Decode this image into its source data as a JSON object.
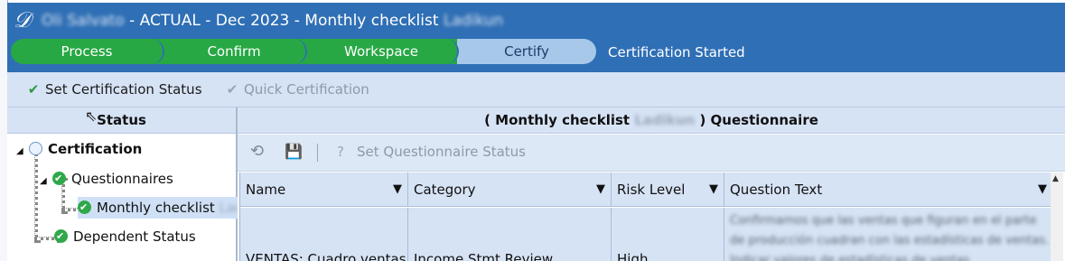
{
  "header": {
    "entity_name": "Oli Salvato",
    "separator1": "-",
    "scenario": "ACTUAL",
    "separator2": "-",
    "period": "Dec 2023",
    "separator3": "-",
    "workflow": "Monthly checklist",
    "workflow_suffix": "Ladikun",
    "steps": [
      {
        "label": "Process",
        "state": "done"
      },
      {
        "label": "Confirm",
        "state": "done"
      },
      {
        "label": "Workspace",
        "state": "done"
      },
      {
        "label": "Certify",
        "state": "active"
      }
    ],
    "status_text": "Certification Started",
    "colors": {
      "header_bg": "#2f6fb5",
      "done": "#27a844",
      "active": "#a8c8ea"
    }
  },
  "toolbar": {
    "set_status_label": "Set Certification Status",
    "quick_cert_label": "Quick Certification",
    "set_status_icon": "checkmark-icon",
    "quick_cert_icon": "quick-check-icon"
  },
  "left_panel": {
    "header": "Status",
    "tree": {
      "root": "Certification",
      "questionnaires": "Questionnaires",
      "monthly": "Monthly checklist",
      "monthly_suffix": "Lad",
      "dependent": "Dependent Status"
    }
  },
  "right_panel": {
    "title_open": "( Monthly checklist",
    "title_blur": "Ladikun",
    "title_close": ")  Questionnaire",
    "set_q_status_label": "Set Questionnaire Status",
    "columns": [
      "Name",
      "Category",
      "Risk Level",
      "Question Text"
    ],
    "row": {
      "name": "VENTAS: Cuadro ventas l",
      "category": "Income Stmt Review",
      "risk": "High",
      "question_text": "Confirmamos que las ventas que figuran en el parte de producción cuadran con las estadísticas de ventas. Indicar valores de estadísticas de ventas"
    }
  }
}
